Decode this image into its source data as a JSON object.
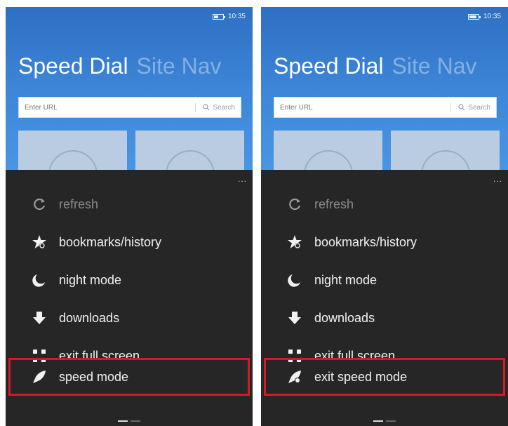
{
  "colors": {
    "header_blue": "#3d86d8",
    "menu_bg": "#262626",
    "highlight_red": "#d41a22"
  },
  "screens": [
    {
      "status_time": "10:35",
      "header": {
        "active_tab": "Speed Dial",
        "inactive_tab": "Site Nav"
      },
      "url": {
        "placeholder": "Enter URL",
        "search_label": "Search"
      },
      "more_label": "...",
      "menu": [
        {
          "label": "refresh",
          "icon": "refresh-icon"
        },
        {
          "label": "bookmarks/history",
          "icon": "star-bookmark-icon"
        },
        {
          "label": "night mode",
          "icon": "moon-icon"
        },
        {
          "label": "downloads",
          "icon": "download-arrow-icon"
        },
        {
          "label": "exit full screen",
          "icon": "exit-fullscreen-icon"
        },
        {
          "label": "speed mode",
          "icon": "rocket-icon"
        }
      ]
    },
    {
      "status_time": "10:35",
      "header": {
        "active_tab": "Speed Dial",
        "inactive_tab": "Site Nav"
      },
      "url": {
        "placeholder": "Enter URL",
        "search_label": "Search"
      },
      "more_label": "...",
      "menu": [
        {
          "label": "refresh",
          "icon": "refresh-icon"
        },
        {
          "label": "bookmarks/history",
          "icon": "star-bookmark-icon"
        },
        {
          "label": "night mode",
          "icon": "moon-icon"
        },
        {
          "label": "downloads",
          "icon": "download-arrow-icon"
        },
        {
          "label": "exit full screen",
          "icon": "exit-fullscreen-icon"
        },
        {
          "label": "exit speed mode",
          "icon": "rocket-off-icon"
        }
      ]
    }
  ]
}
